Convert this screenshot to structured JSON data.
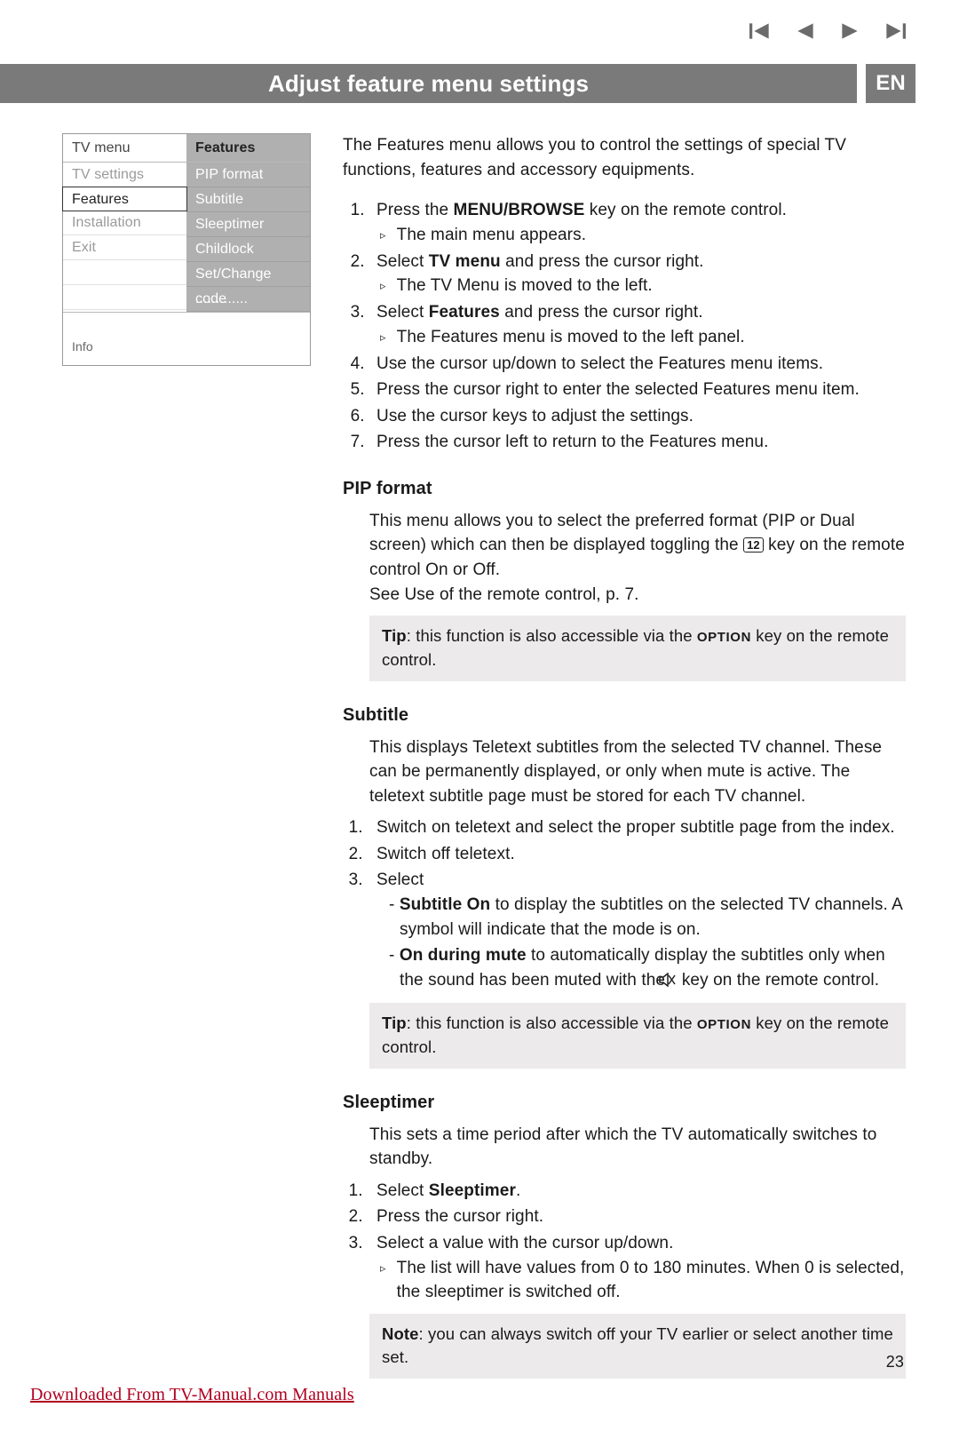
{
  "nav": {
    "first": "skip-back",
    "prev": "prev",
    "next": "next",
    "last": "skip-forward"
  },
  "title": "Adjust feature menu settings",
  "lang": "EN",
  "menu": {
    "left_header": "TV menu",
    "right_header": "Features",
    "left_items": [
      "TV settings",
      "Features",
      "Installation",
      "Exit"
    ],
    "left_selected_index": 1,
    "right_items": [
      "PIP format",
      "Subtitle",
      "Sleeptimer",
      "Childlock",
      "Set/Change code",
      "............."
    ],
    "info_label": "Info"
  },
  "intro": "The Features menu allows you to control the settings of special TV functions, features and accessory equipments.",
  "steps": [
    {
      "pre": "Press the ",
      "bold": "MENU/BROWSE",
      "post": " key on the remote control.",
      "sub": "The main menu appears."
    },
    {
      "pre": "Select ",
      "bold": "TV menu",
      "post": " and press the cursor right.",
      "sub": "The TV Menu is moved to the left."
    },
    {
      "pre": "Select ",
      "bold": "Features",
      "post": " and press the cursor right.",
      "sub": "The Features menu is moved to the left panel."
    },
    {
      "plain": "Use the cursor up/down to select the Features menu items."
    },
    {
      "plain": "Press the cursor right to enter the selected Features menu item."
    },
    {
      "plain": "Use the cursor keys to adjust the settings."
    },
    {
      "plain": "Press the cursor left to return to the Features menu."
    }
  ],
  "pip": {
    "heading": "PIP format",
    "body1": "This menu allows you to select the preferred format (PIP or Dual screen) which can then be displayed toggling the ",
    "key": "12",
    "body2": " key on the remote control On or Off.",
    "body3": "See Use of the remote control, p. 7.",
    "tip_label": "Tip",
    "tip_text": ": this function is also accessible via the ",
    "tip_key": "OPTION",
    "tip_tail": " key on the remote control."
  },
  "subtitle": {
    "heading": "Subtitle",
    "body": "This displays Teletext subtitles from the selected TV channel. These can be permanently displayed, or only when mute is active. The teletext subtitle page must be stored for each TV channel.",
    "steps": [
      "Switch on teletext and select the proper subtitle page from the index.",
      "Switch off teletext.",
      "Select"
    ],
    "dash": [
      {
        "bold": "Subtitle On",
        "text": " to display the subtitles on the selected TV channels.  A symbol will indicate that the mode is on."
      },
      {
        "bold": "On during mute",
        "text_a": " to automatically display the subtitles only when the sound has been muted with the ",
        "text_b": " key on the remote control."
      }
    ],
    "tip_label": "Tip",
    "tip_text": ": this function is also accessible via the ",
    "tip_key": "OPTION",
    "tip_tail": " key on the remote control."
  },
  "sleep": {
    "heading": "Sleeptimer",
    "body": "This sets a time period after which the TV automatically switches to standby.",
    "steps": [
      {
        "pre": "Select ",
        "bold": "Sleeptimer",
        "post": "."
      },
      {
        "plain": "Press the cursor right."
      },
      {
        "plain": "Select a value with the cursor up/down.",
        "sub": "The list will have values from 0 to 180 minutes. When 0 is selected, the sleeptimer is switched off."
      }
    ],
    "note_label": "Note",
    "note_text": ": you can always switch off your TV earlier or select another time set."
  },
  "page_number": "23",
  "footer": "Downloaded From TV-Manual.com Manuals"
}
